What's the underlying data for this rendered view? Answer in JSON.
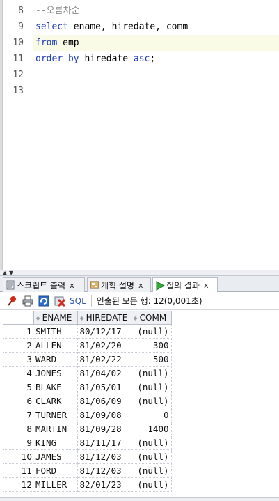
{
  "editor": {
    "lines": [
      {
        "no": "8",
        "segments": [
          {
            "t": "--오름차순",
            "c": "cm"
          }
        ]
      },
      {
        "no": "9",
        "segments": [
          {
            "t": "select",
            "c": "kw"
          },
          {
            "t": " ename, hiredate, comm",
            "c": ""
          }
        ]
      },
      {
        "no": "10",
        "segments": [
          {
            "t": "from",
            "c": "kw"
          },
          {
            "t": " emp",
            "c": ""
          }
        ],
        "current": true
      },
      {
        "no": "11",
        "segments": [
          {
            "t": "order",
            "c": "kw"
          },
          {
            "t": " ",
            "c": ""
          },
          {
            "t": "by",
            "c": "kw"
          },
          {
            "t": " hiredate ",
            "c": ""
          },
          {
            "t": "asc",
            "c": "kw"
          },
          {
            "t": ";",
            "c": ""
          }
        ]
      },
      {
        "no": "12",
        "segments": []
      },
      {
        "no": "13",
        "segments": []
      }
    ]
  },
  "tabs": [
    {
      "label": "스크립트 출력",
      "icon": "script-output-icon"
    },
    {
      "label": "계획 설명",
      "icon": "explain-plan-icon"
    },
    {
      "label": "질의 결과",
      "icon": "query-result-icon"
    }
  ],
  "toolbar": {
    "sql_label": "SQL",
    "status": "인출된 모든 행: 12(0,001초)"
  },
  "results": {
    "columns": [
      "ENAME",
      "HIREDATE",
      "COMM"
    ],
    "rows": [
      [
        "1",
        "SMITH",
        "80/12/17",
        "(null)"
      ],
      [
        "2",
        "ALLEN",
        "81/02/20",
        "300"
      ],
      [
        "3",
        "WARD",
        "81/02/22",
        "500"
      ],
      [
        "4",
        "JONES",
        "81/04/02",
        "(null)"
      ],
      [
        "5",
        "BLAKE",
        "81/05/01",
        "(null)"
      ],
      [
        "6",
        "CLARK",
        "81/06/09",
        "(null)"
      ],
      [
        "7",
        "TURNER",
        "81/09/08",
        "0"
      ],
      [
        "8",
        "MARTIN",
        "81/09/28",
        "1400"
      ],
      [
        "9",
        "KING",
        "81/11/17",
        "(null)"
      ],
      [
        "10",
        "JAMES",
        "81/12/03",
        "(null)"
      ],
      [
        "11",
        "FORD",
        "81/12/03",
        "(null)"
      ],
      [
        "12",
        "MILLER",
        "82/01/23",
        "(null)"
      ]
    ]
  }
}
